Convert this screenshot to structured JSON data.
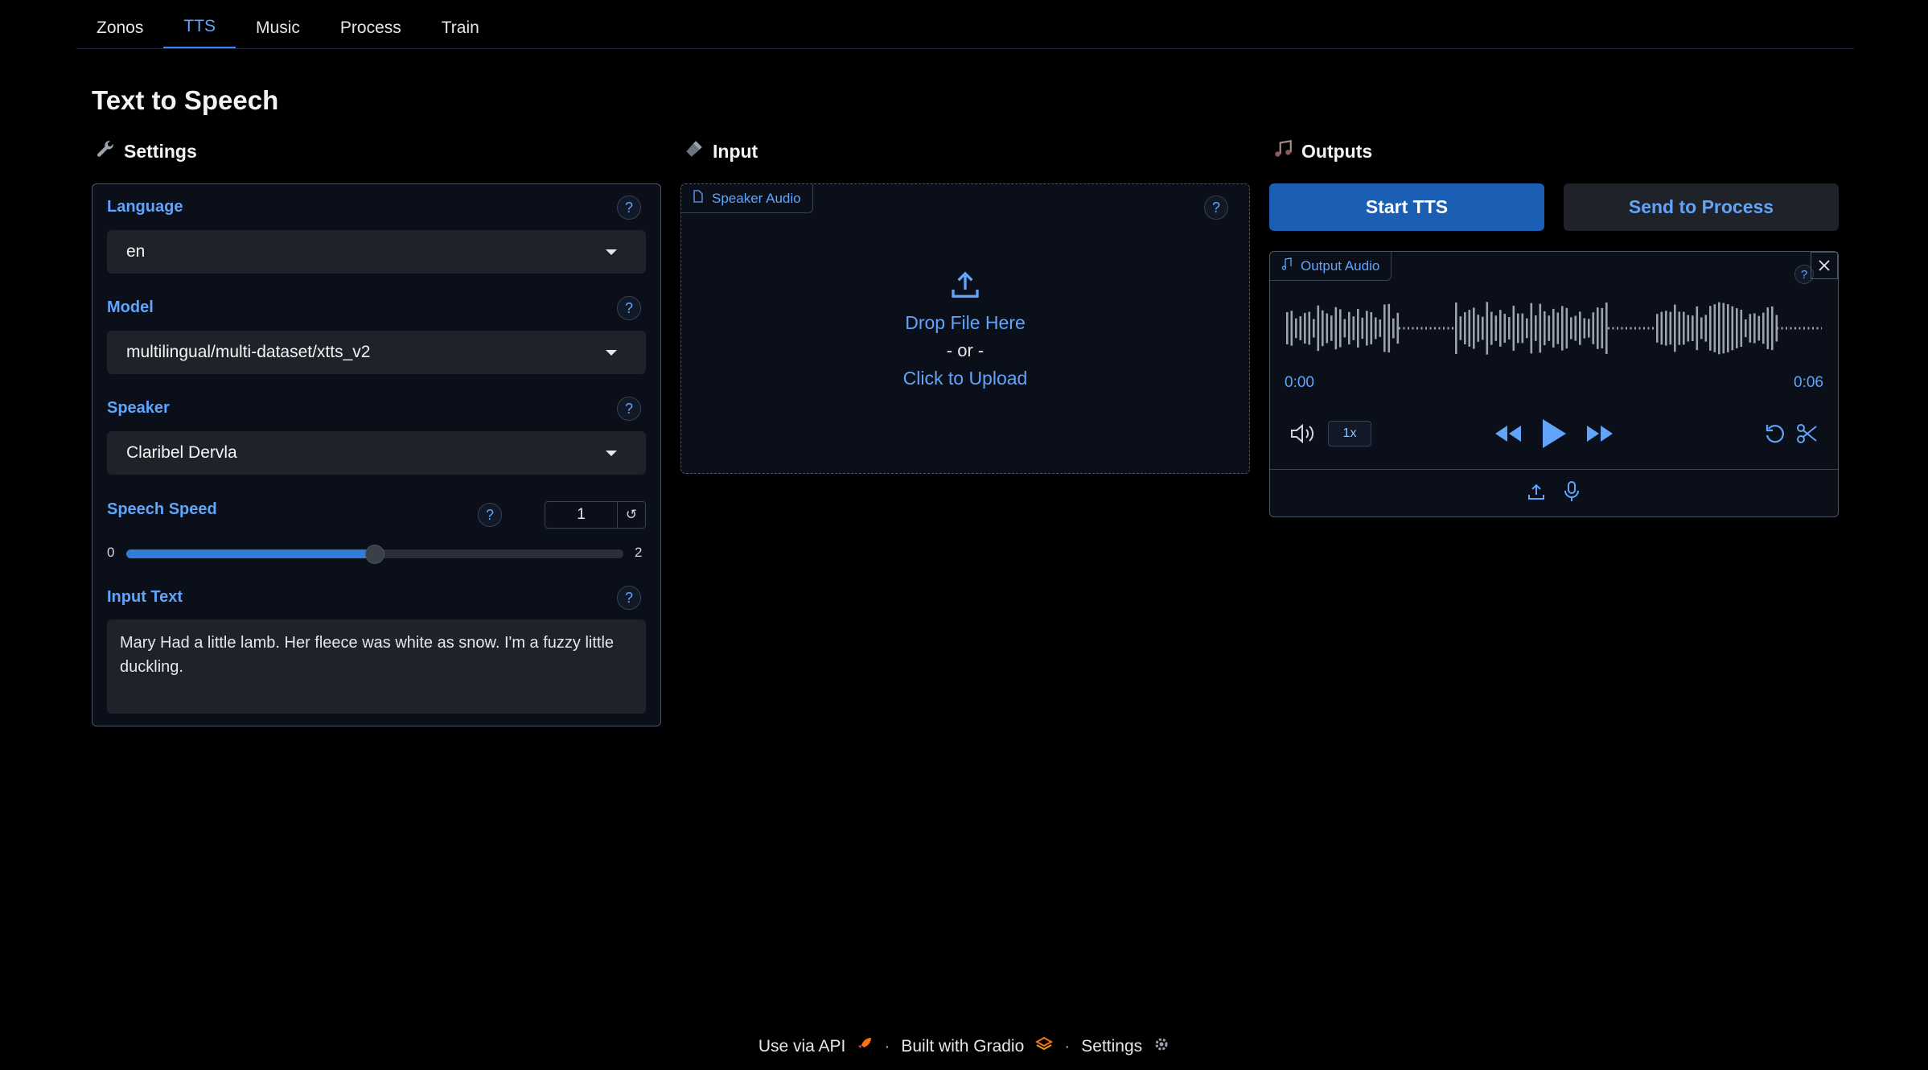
{
  "tabs": [
    {
      "label": "Zonos",
      "active": false
    },
    {
      "label": "TTS",
      "active": true
    },
    {
      "label": "Music",
      "active": false
    },
    {
      "label": "Process",
      "active": false
    },
    {
      "label": "Train",
      "active": false
    }
  ],
  "page_title": "Text to Speech",
  "settings": {
    "title": "Settings",
    "icon": "wrench-icon",
    "language": {
      "label": "Language",
      "value": "en",
      "help": "?"
    },
    "model": {
      "label": "Model",
      "value": "multilingual/multi-dataset/xtts_v2",
      "help": "?"
    },
    "speaker": {
      "label": "Speaker",
      "value": "Claribel Dervla",
      "help": "?"
    },
    "speech_speed": {
      "label": "Speech Speed",
      "value": "1",
      "min": "0",
      "max": "2",
      "help": "?",
      "reset": "↺"
    },
    "input_text": {
      "label": "Input Text",
      "value": "Mary Had a little lamb. Her fleece was white as snow. I'm a fuzzy little duckling.",
      "help": "?"
    }
  },
  "input": {
    "title": "Input",
    "icon": "microphone-icon",
    "speaker_audio": {
      "label": "Speaker Audio",
      "help": "?",
      "drop_text": "Drop File Here",
      "or_text": "- or -",
      "click_text": "Click to Upload"
    }
  },
  "outputs": {
    "title": "Outputs",
    "icon": "music-notes-icon",
    "start_button": "Start TTS",
    "send_button": "Send to Process",
    "output_audio": {
      "label": "Output Audio",
      "help": "?",
      "current_time": "0:00",
      "duration": "0:06",
      "rate": "1x"
    }
  },
  "footer": {
    "api": "Use via API",
    "built": "Built with Gradio",
    "settings": "Settings",
    "sep": "·"
  },
  "colors": {
    "accent": "#60a5fa",
    "primary_button": "#1a5fb4",
    "background": "#000000",
    "panel": "#0b0f19"
  }
}
